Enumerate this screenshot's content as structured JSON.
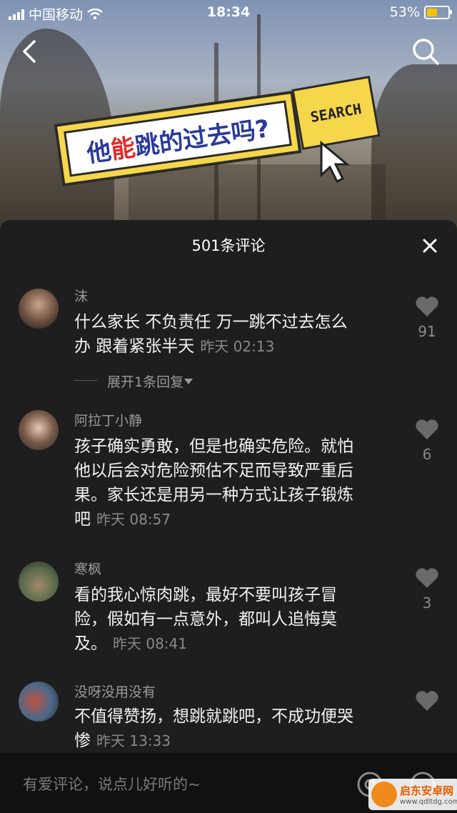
{
  "status_bar": {
    "carrier": "中国移动",
    "time": "18:34",
    "battery": "53%",
    "battery_level": 0.53
  },
  "video": {
    "sticker_text_a": "他",
    "sticker_text_b": "能",
    "sticker_text_c": "跳的过去吗?",
    "search_tag": "SEARCH"
  },
  "panel": {
    "title": "501条评论"
  },
  "comments": [
    {
      "username": "沫",
      "text_line1": "什么家长 不负责任 万一跳不过去怎么",
      "text_line2": "办 跟着紧张半天",
      "time": "昨天 02:13",
      "likes": "91",
      "expand": "展开1条回复"
    },
    {
      "username": "阿拉丁小静",
      "text_line1": "孩子确实勇敢，但是也确实危险。就怕",
      "text_line2": "他以后会对危险预估不足而导致严重后",
      "text_line3": "果。家长还是用另一种方式让孩子锻炼",
      "text_line4": "吧",
      "time": "昨天 08:57",
      "likes": "6"
    },
    {
      "username": "寒枫",
      "text_line1": "看的我心惊肉跳，最好不要叫孩子冒",
      "text_line2": "险，假如有一点意外，都叫人追悔莫",
      "text_line3": "及。",
      "time": "昨天 08:41",
      "likes": "3"
    },
    {
      "username": "没呀没用没有",
      "text_line1": "不值得赞扬，想跳就跳吧，不成功便哭",
      "text_line2": "惨",
      "time": "昨天 13:33"
    }
  ],
  "input": {
    "placeholder": "有爱评论，说点儿好听的~"
  },
  "watermark": {
    "title": "启东安卓网",
    "url": "www.qdltdg.com"
  },
  "colors": {
    "panel_bg": "#1e1e1e",
    "sticker_yellow": "#f6d64a",
    "battery_yellow": "#f5c400"
  }
}
